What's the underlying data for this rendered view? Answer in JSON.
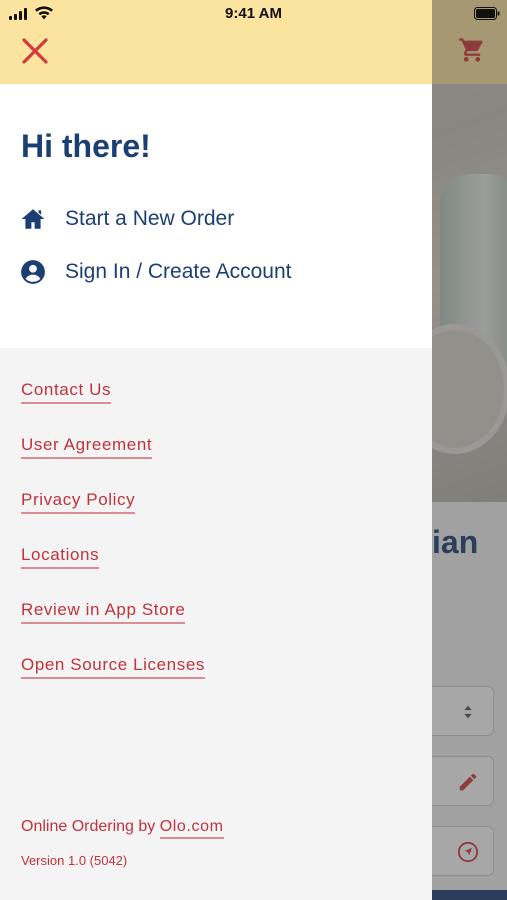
{
  "status_bar": {
    "time": "9:41 AM"
  },
  "background": {
    "title_fragment": "ian"
  },
  "drawer": {
    "greeting": "Hi there!",
    "menu": [
      {
        "label": "Start a New Order",
        "icon": "home-icon"
      },
      {
        "label": "Sign In / Create Account",
        "icon": "account-circle-icon"
      }
    ],
    "links": [
      {
        "label": "Contact Us"
      },
      {
        "label": "User Agreement"
      },
      {
        "label": "Privacy Policy"
      },
      {
        "label": "Locations"
      },
      {
        "label": "Review in App Store"
      },
      {
        "label": "Open Source Licenses"
      }
    ],
    "footer": {
      "prefix": "Online Ordering by ",
      "link": "Olo.com",
      "version": "Version 1.0 (5042)"
    }
  },
  "colors": {
    "header": "#fbe3a0",
    "primary_text": "#1c3f73",
    "link": "#c0323d",
    "drawer_bg": "#f4f4f4",
    "close_icon": "#d13b3b"
  }
}
